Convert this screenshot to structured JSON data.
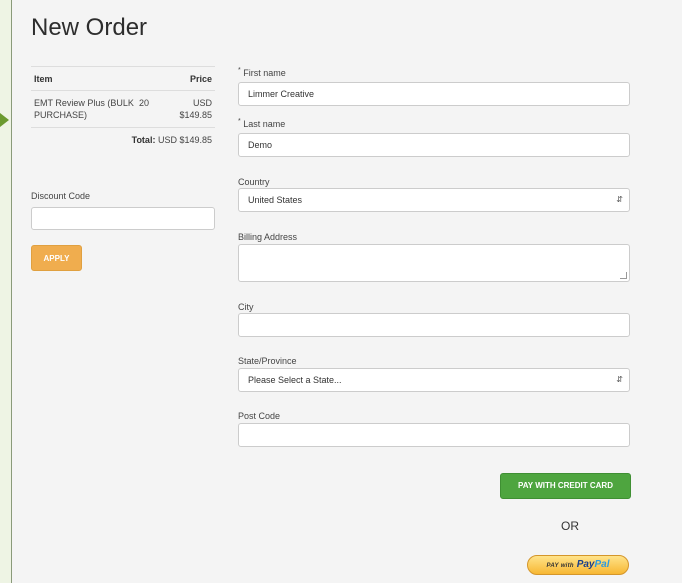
{
  "page": {
    "title": "New Order"
  },
  "order_table": {
    "headers": {
      "item": "Item",
      "price": "Price"
    },
    "rows": [
      {
        "item": "EMT Review Plus (BULK PURCHASE)",
        "qty": "20",
        "price": "USD $149.85"
      }
    ],
    "total_label": "Total:",
    "total_value": "USD $149.85"
  },
  "discount": {
    "label": "Discount Code",
    "value": "",
    "apply_label": "APPLY"
  },
  "form": {
    "first_name": {
      "label": "First name",
      "required_mark": "*",
      "value": "Limmer Creative"
    },
    "last_name": {
      "label": "Last name",
      "required_mark": "*",
      "value": "Demo"
    },
    "country": {
      "label": "Country",
      "value": "United States"
    },
    "billing_address": {
      "label": "Billing Address",
      "value": ""
    },
    "city": {
      "label": "City",
      "value": ""
    },
    "state": {
      "label": "State/Province",
      "value": "Please Select a State..."
    },
    "post_code": {
      "label": "Post Code",
      "value": ""
    }
  },
  "actions": {
    "pay_credit_label": "PAY WITH CREDIT CARD",
    "or_label": "OR",
    "paypal": {
      "prefix": "PAY with",
      "brand_pay": "Pay",
      "brand_pal": "Pal"
    }
  },
  "colors": {
    "apply": "#f0ad4e",
    "pay_credit": "#4ea53f",
    "paypal_gold": "#f7b733",
    "page_bg": "#f4f4f4",
    "frame_bg": "#eef4e4"
  },
  "icons": {
    "select_caret": "up-down-caret-icon",
    "indicator": "arrow-right-icon"
  }
}
